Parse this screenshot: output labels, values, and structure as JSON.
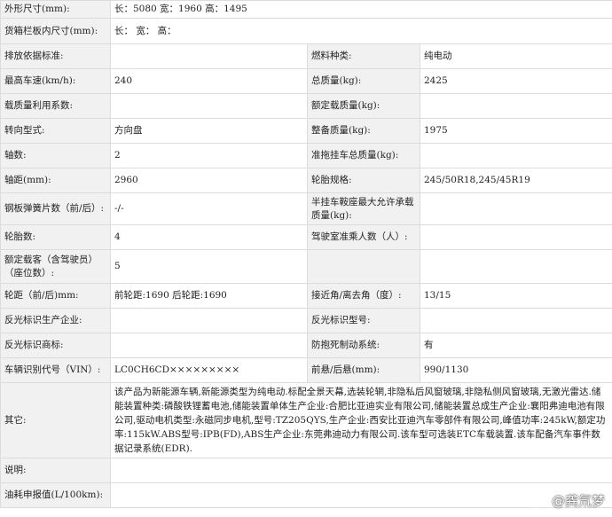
{
  "rows": {
    "r1": {
      "label": "外形尺寸(mm):",
      "value": "长：5080 宽：1960 高：1495"
    },
    "r2": {
      "label": "货箱栏板内尺寸(mm):",
      "value": "长：    宽：    高："
    },
    "r3": {
      "label1": "排放依据标准:",
      "value1": "",
      "label2": "燃料种类:",
      "value2": "纯电动"
    },
    "r4": {
      "label1": "最高车速(km/h):",
      "value1": "240",
      "label2": "总质量(kg):",
      "value2": "2425"
    },
    "r5": {
      "label1": "载质量利用系数:",
      "value1": "",
      "label2": "额定载质量(kg):",
      "value2": ""
    },
    "r6": {
      "label1": "转向型式:",
      "value1": "方向盘",
      "label2": "整备质量(kg):",
      "value2": "1975"
    },
    "r7": {
      "label1": "轴数:",
      "value1": "2",
      "label2": "准拖挂车总质量(kg):",
      "value2": ""
    },
    "r8": {
      "label1": "轴距(mm):",
      "value1": "2960",
      "label2": "轮胎规格:",
      "value2": "245/50R18,245/45R19"
    },
    "r9": {
      "label1": "钢板弹簧片数（前/后）:",
      "value1": "-/-",
      "label2": "半挂车鞍座最大允许承载质量(kg):",
      "value2": ""
    },
    "r10": {
      "label1": "轮胎数:",
      "value1": "4",
      "label2": "驾驶室准乘人数（人）:",
      "value2": ""
    },
    "r11": {
      "label1": "额定载客（含驾驶员）（座位数）:",
      "value1": "5",
      "label2": "",
      "value2": ""
    },
    "r12": {
      "label1": "轮距（前/后)mm:",
      "value1": "前轮距:1690 后轮距:1690",
      "label2": "接近角/离去角（度）:",
      "value2": "13/15"
    },
    "r13": {
      "label1": "反光标识生产企业:",
      "value1": "",
      "label2": "反光标识型号:",
      "value2": ""
    },
    "r14": {
      "label1": "反光标识商标:",
      "value1": "",
      "label2": "防抱死制动系统:",
      "value2": "有"
    },
    "r15": {
      "label1": "车辆识别代号（VIN）:",
      "value1": "LC0CH6CD×××××××××",
      "label2": "前悬/后悬(mm):",
      "value2": "990/1130"
    },
    "r16": {
      "label": "其它:",
      "value": "该产品为新能源车辆,新能源类型为纯电动.标配全景天幕,选装轮辋,非隐私后风窗玻璃,非隐私侧风窗玻璃,无激光雷达.储能装置种类:磷酸铁锂蓄电池,储能装置单体生产企业:合肥比亚迪实业有限公司,储能装置总成生产企业:襄阳弗迪电池有限公司,驱动电机类型:永磁同步电机,型号:TZ205QYS,生产企业:西安比亚迪汽车零部件有限公司,峰值功率:245kW,额定功率:115kW.ABS型号:IPB(FD),ABS生产企业:东莞弗迪动力有限公司.该车型可选装ETC车载装置.该车配备汽车事件数据记录系统(EDR)."
    },
    "r17": {
      "label": "说明:",
      "value": ""
    },
    "r18": {
      "label": "油耗申报值(L/100km):",
      "value": ""
    }
  },
  "watermark": {
    "text": "@龚氘梦",
    "icon": "weibo-icon"
  }
}
